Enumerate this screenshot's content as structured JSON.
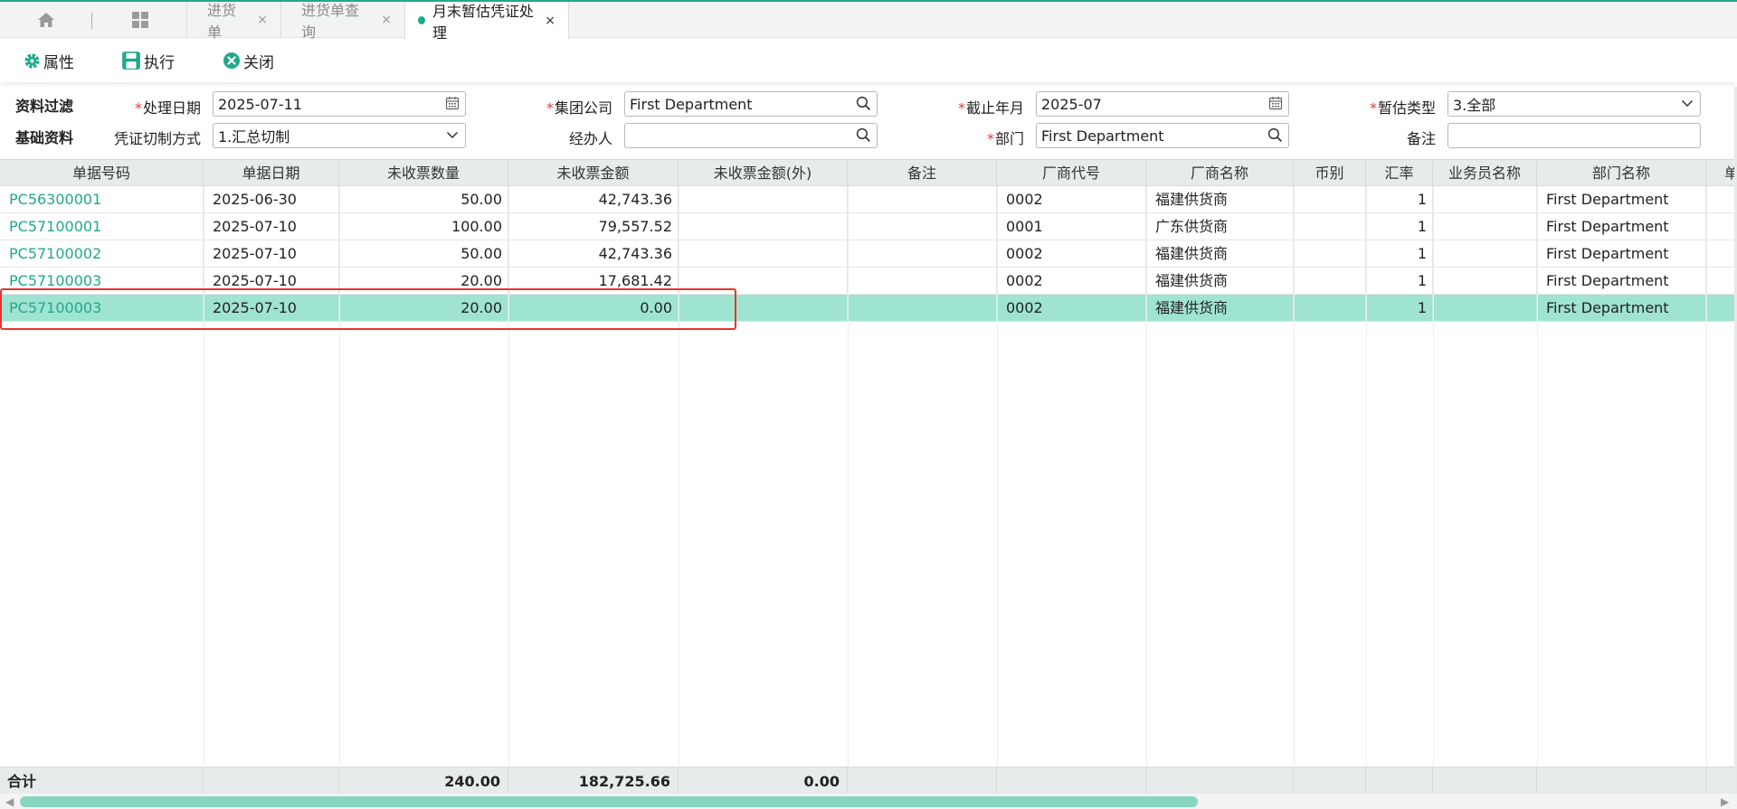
{
  "tabs": {
    "home_icon": "home-icon",
    "grid_icon": "grid-icon",
    "items": [
      {
        "label": "进货单",
        "close": "×"
      },
      {
        "label": "进货单查询",
        "close": "×"
      },
      {
        "label": "月末暂估凭证处理",
        "close": "×",
        "active": true
      }
    ]
  },
  "toolbar": {
    "properties_label": "属性",
    "execute_label": "执行",
    "close_label": "关闭"
  },
  "filter": {
    "section_filter": "资料过滤",
    "section_basic": "基础资料",
    "required_mark": "*",
    "process_date_label": "处理日期",
    "process_date_value": "2025-07-11",
    "group_company_label": "集团公司",
    "group_company_value": "First Department",
    "cutoff_month_label": "截止年月",
    "cutoff_month_value": "2025-07",
    "estimate_type_label": "暂估类型",
    "estimate_type_value": "3.全部",
    "voucher_split_label": "凭证切制方式",
    "voucher_split_value": "1.汇总切制",
    "handler_label": "经办人",
    "handler_value": "",
    "department_label": "部门",
    "department_value": "First Department",
    "remark_label": "备注",
    "remark_value": ""
  },
  "grid": {
    "columns": [
      "单据号码",
      "单据日期",
      "未收票数量",
      "未收票金额",
      "未收票金额(外)",
      "备注",
      "厂商代号",
      "厂商名称",
      "币别",
      "汇率",
      "业务员名称",
      "部门名称",
      "单"
    ],
    "rows": [
      [
        "PC56300001",
        "2025-06-30",
        "50.00",
        "42,743.36",
        "",
        "",
        "0002",
        "福建供货商",
        "",
        "1",
        "",
        "First Department"
      ],
      [
        "PC57100001",
        "2025-07-10",
        "100.00",
        "79,557.52",
        "",
        "",
        "0001",
        "广东供货商",
        "",
        "1",
        "",
        "First Department"
      ],
      [
        "PC57100002",
        "2025-07-10",
        "50.00",
        "42,743.36",
        "",
        "",
        "0002",
        "福建供货商",
        "",
        "1",
        "",
        "First Department"
      ],
      [
        "PC57100003",
        "2025-07-10",
        "20.00",
        "17,681.42",
        "",
        "",
        "0002",
        "福建供货商",
        "",
        "1",
        "",
        "First Department"
      ],
      [
        "PC57100003",
        "2025-07-10",
        "20.00",
        "0.00",
        "",
        "",
        "0002",
        "福建供货商",
        "",
        "1",
        "",
        "First Department"
      ]
    ],
    "selected_row": 4
  },
  "footer": {
    "total_label": "合计",
    "total_qty": "240.00",
    "total_amount": "182,725.66",
    "total_amount_foreign": "0.00"
  },
  "colors": {
    "accent": "#21a98a",
    "selected_row": "#9fe3d1",
    "highlight_border": "#e8332f",
    "required": "#e03a3a"
  }
}
